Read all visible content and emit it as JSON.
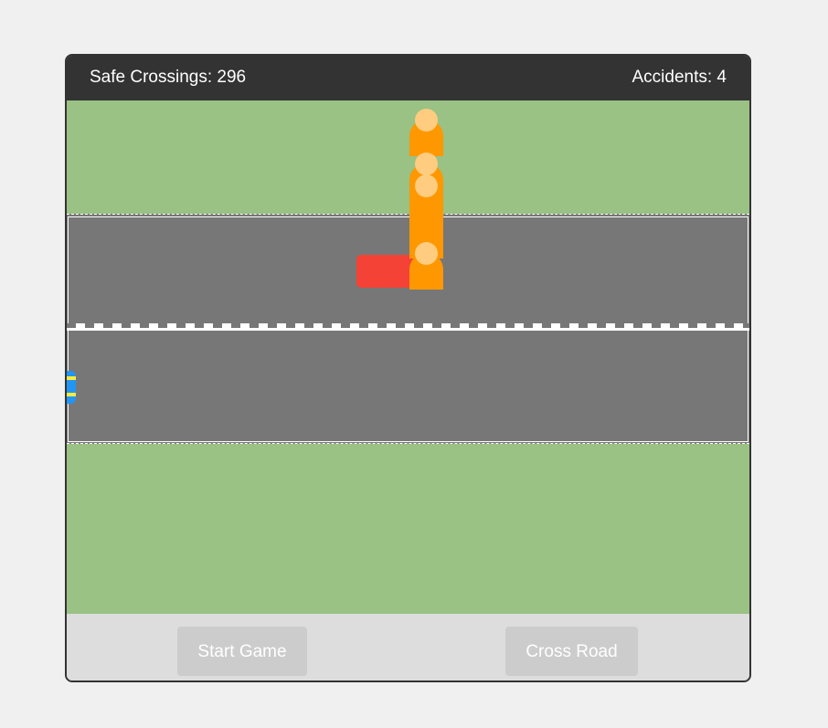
{
  "hud": {
    "safe_crossings_label": "Safe Crossings: 296",
    "accidents_label": "Accidents: 4"
  },
  "controls": {
    "start_label": "Start Game",
    "cross_label": "Cross Road"
  },
  "colors": {
    "grass": "#99c284",
    "road": "#777777",
    "hud_bg": "#333333",
    "pedestrian_body": "#ff9800",
    "pedestrian_head": "#ffcc80",
    "car_red": "#f44336",
    "car_blue": "#2196f3",
    "headlight": "#ffeb3b"
  },
  "sprites": {
    "cars": [
      "car-red",
      "car-blue"
    ],
    "pedestrians": 4
  }
}
